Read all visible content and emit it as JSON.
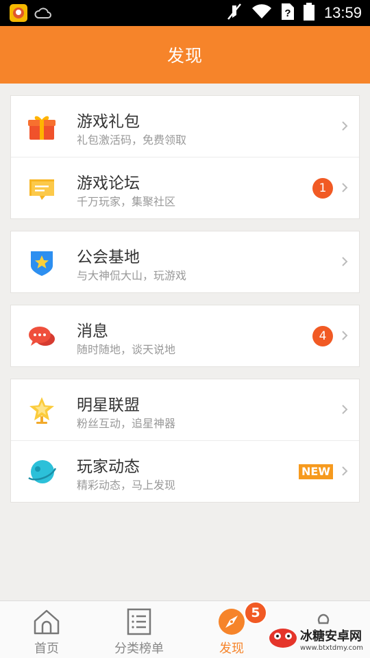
{
  "status_bar": {
    "time": "13:59"
  },
  "header": {
    "title": "发现"
  },
  "sections": [
    {
      "rows": [
        {
          "title": "游戏礼包",
          "subtitle": "礼包激活码，免费领取"
        },
        {
          "title": "游戏论坛",
          "subtitle": "千万玩家，集聚社区",
          "badge": "1"
        }
      ]
    },
    {
      "rows": [
        {
          "title": "公会基地",
          "subtitle": "与大神侃大山，玩游戏"
        }
      ]
    },
    {
      "rows": [
        {
          "title": "消息",
          "subtitle": "随时随地，谈天说地",
          "badge": "4"
        }
      ]
    },
    {
      "rows": [
        {
          "title": "明星联盟",
          "subtitle": "粉丝互动，追星神器"
        },
        {
          "title": "玩家动态",
          "subtitle": "精彩动态，马上发现",
          "tag": "NEW"
        }
      ]
    }
  ],
  "bottom_nav": {
    "items": [
      {
        "label": "首页"
      },
      {
        "label": "分类榜单"
      },
      {
        "label": "发现",
        "badge": "5"
      },
      {
        "label": ""
      }
    ]
  },
  "watermark": {
    "name": "冰糖安卓网",
    "url": "www.btxtdmy.com"
  },
  "colors": {
    "accent": "#f6842a",
    "badge": "#f15a24",
    "new_tag": "#f69a1e"
  }
}
